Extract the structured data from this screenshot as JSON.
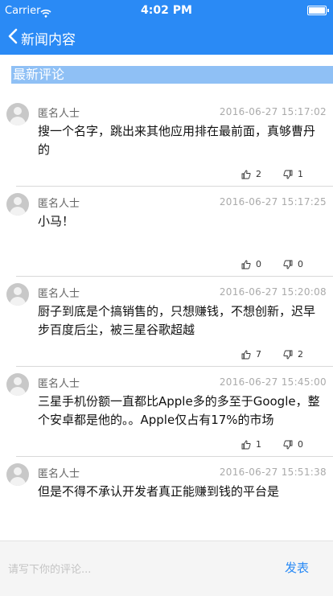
{
  "status_bar": {
    "carrier": "Carrier",
    "time": "4:02 PM"
  },
  "nav": {
    "title": "新闻内容"
  },
  "section": {
    "title": "最新评论"
  },
  "comments": [
    {
      "author": "匿名人士",
      "time": "2016-06-27 15:17:02",
      "text": "搜一个名字，跳出来其他应用排在最前面，真够曹丹的",
      "likes": "2",
      "dislikes": "1"
    },
    {
      "author": "匿名人士",
      "time": "2016-06-27 15:17:25",
      "text": "小马！",
      "likes": "0",
      "dislikes": "0"
    },
    {
      "author": "匿名人士",
      "time": "2016-06-27 15:20:08",
      "text": "厨子到底是个搞销售的，只想赚钱，不想创新，迟早步百度后尘，被三星谷歌超越",
      "likes": "7",
      "dislikes": "2"
    },
    {
      "author": "匿名人士",
      "time": "2016-06-27 15:45:00",
      "text": "三星手机份额一直都比Apple多的多至于Google，整个安卓都是他的。。Apple仅占有17%的市场",
      "likes": "1",
      "dislikes": "0"
    },
    {
      "author": "匿名人士",
      "time": "2016-06-27 15:51:38",
      "text": "但是不得不承认开发者真正能赚到钱的平台是",
      "likes": "",
      "dislikes": ""
    }
  ],
  "input": {
    "placeholder": "请写下你的评论...",
    "send_label": "发表"
  },
  "colors": {
    "accent": "#2a8af5",
    "section_bg": "#8fc0f5"
  },
  "icons": {
    "back": "chevron-left-icon",
    "like": "thumbs-up-icon",
    "dislike": "thumbs-down-icon",
    "avatar": "default-avatar-icon"
  }
}
